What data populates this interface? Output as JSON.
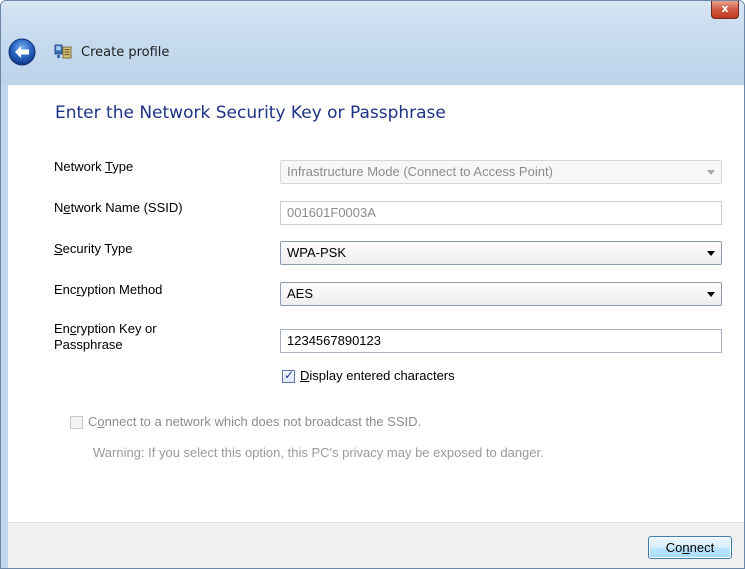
{
  "window": {
    "close_label": "x"
  },
  "header": {
    "title": "Create profile"
  },
  "main": {
    "heading": "Enter the Network Security Key or Passphrase",
    "network_type": {
      "label_pre": "Network ",
      "label_ul": "T",
      "label_post": "ype",
      "value": "Infrastructure Mode (Connect to Access Point)"
    },
    "ssid": {
      "label_pre": "N",
      "label_ul": "e",
      "label_post": "twork Name (SSID)",
      "value": "001601F0003A"
    },
    "security_type": {
      "label_pre": "",
      "label_ul": "S",
      "label_post": "ecurity Type",
      "value": "WPA-PSK"
    },
    "encryption_method": {
      "label_pre": "Enc",
      "label_ul": "r",
      "label_post": "yption Method",
      "value": "AES"
    },
    "encryption_key": {
      "label_pre": "En",
      "label_ul": "c",
      "label_post": "ryption Key or",
      "label_line2": "Passphrase",
      "value": "1234567890123"
    },
    "display_chars": {
      "label_pre": "",
      "label_ul": "D",
      "label_post": "isplay entered characters",
      "checked": true
    },
    "hidden_ssid": {
      "label_pre": "C",
      "label_ul": "o",
      "label_post": "nnect to a network which does not broadcast the SSID.",
      "checked": false
    },
    "warning": "Warning: If you select this option, this PC's privacy may be exposed to danger."
  },
  "footer": {
    "connect_pre": "Co",
    "connect_ul": "n",
    "connect_post": "nect"
  }
}
